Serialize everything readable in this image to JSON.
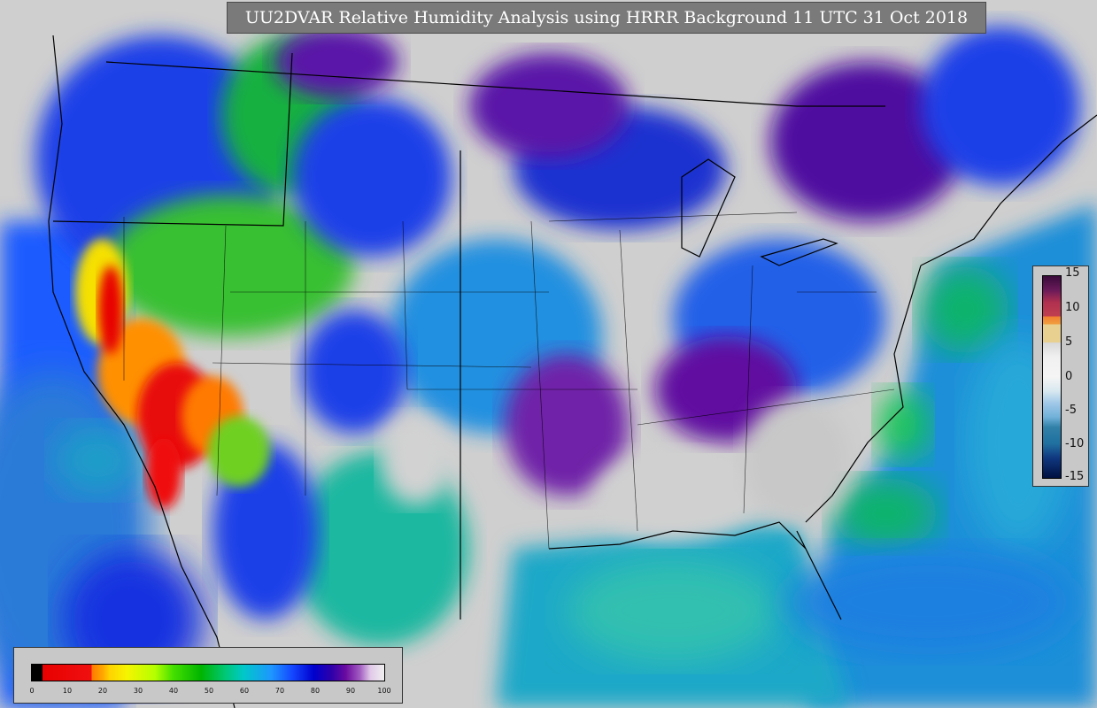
{
  "title": "UU2DVAR Relative Humidity Analysis using HRRR Background 11 UTC 31 Oct 2018",
  "colorbar": {
    "label_0": "0",
    "label_10": "10",
    "label_20": "20",
    "label_30": "30",
    "label_40": "40",
    "label_50": "50",
    "label_60": "60",
    "label_70": "70",
    "label_80": "80",
    "label_90": "90",
    "label_100": "100"
  },
  "seam_colorbar": {
    "label_15": "15",
    "label_10": "10",
    "label_5": "5",
    "label_0": "0",
    "label_m5": "-5",
    "label_m10": "-10",
    "label_m15": "-15"
  },
  "colors": {
    "land_gray": "#c8c8c8",
    "ocean_blue": "#1446ff",
    "dry_red": "#e80000",
    "moist_purple": "#6a0aa0",
    "green": "#00b400"
  }
}
